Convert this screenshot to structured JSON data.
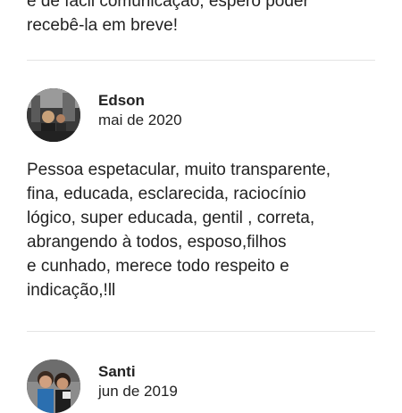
{
  "previous_review": {
    "tail_text": "e de fácil comunicação, espero poder\nrecebê-la em breve!"
  },
  "reviews": [
    {
      "name": "Edson",
      "date": "mai de 2020",
      "text": "Pessoa espetacular, muito transparente,\nfina, educada, esclarecida, raciocínio\nlógico, super educada, gentil , correta,\nabrangendo à todos, esposo,filhos\ne cunhado, merece todo respeito e\nindicação,!ll"
    },
    {
      "name": "Santi",
      "date": "jun de 2019",
      "text": ""
    }
  ]
}
